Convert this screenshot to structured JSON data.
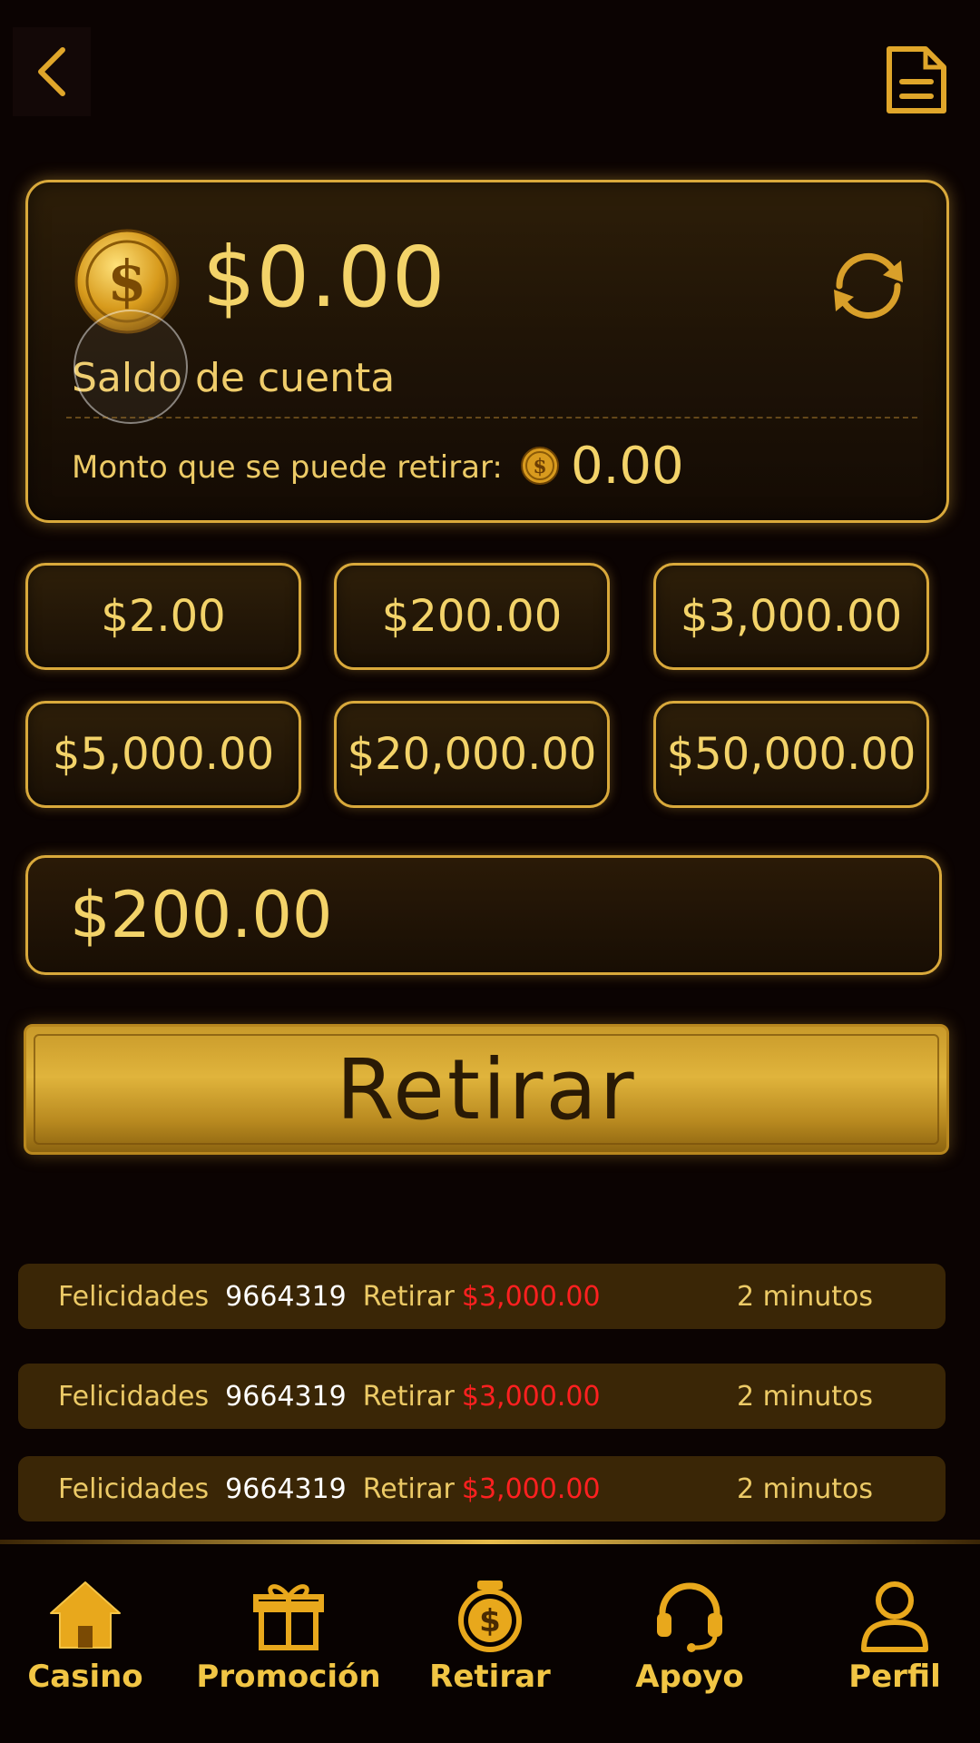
{
  "header": {
    "back_icon": "chevron-left-icon",
    "record_icon": "document-icon"
  },
  "balance": {
    "amount": "$0.00",
    "label": "Saldo de cuenta",
    "withdrawable_label": "Monto que se puede retirar:",
    "withdrawable_value": "0.00"
  },
  "presets": [
    "$2.00",
    "$200.00",
    "$3,000.00",
    "$5,000.00",
    "$20,000.00",
    "$50,000.00"
  ],
  "amount_input": {
    "value": "$200.00"
  },
  "withdraw_button": {
    "label": "Retirar"
  },
  "winners": [
    {
      "label": "Felicidades",
      "id": "9664319",
      "action": "Retirar",
      "amount": "$3,000.00",
      "time": "2 minutos"
    },
    {
      "label": "Felicidades",
      "id": "9664319",
      "action": "Retirar",
      "amount": "$3,000.00",
      "time": "2 minutos"
    },
    {
      "label": "Felicidades",
      "id": "9664319",
      "action": "Retirar",
      "amount": "$3,000.00",
      "time": "2 minutos"
    }
  ],
  "nav": [
    {
      "label": "Casino",
      "icon": "home-icon"
    },
    {
      "label": "Promoción",
      "icon": "gift-icon"
    },
    {
      "label": "Retirar",
      "icon": "money-bag-icon"
    },
    {
      "label": "Apoyo",
      "icon": "headset-icon"
    },
    {
      "label": "Perfil",
      "icon": "user-icon"
    }
  ],
  "colors": {
    "gold": "#f3d369",
    "border_gold": "#d9a93b",
    "background": "#0b0302",
    "amount_red": "#ff2020"
  }
}
